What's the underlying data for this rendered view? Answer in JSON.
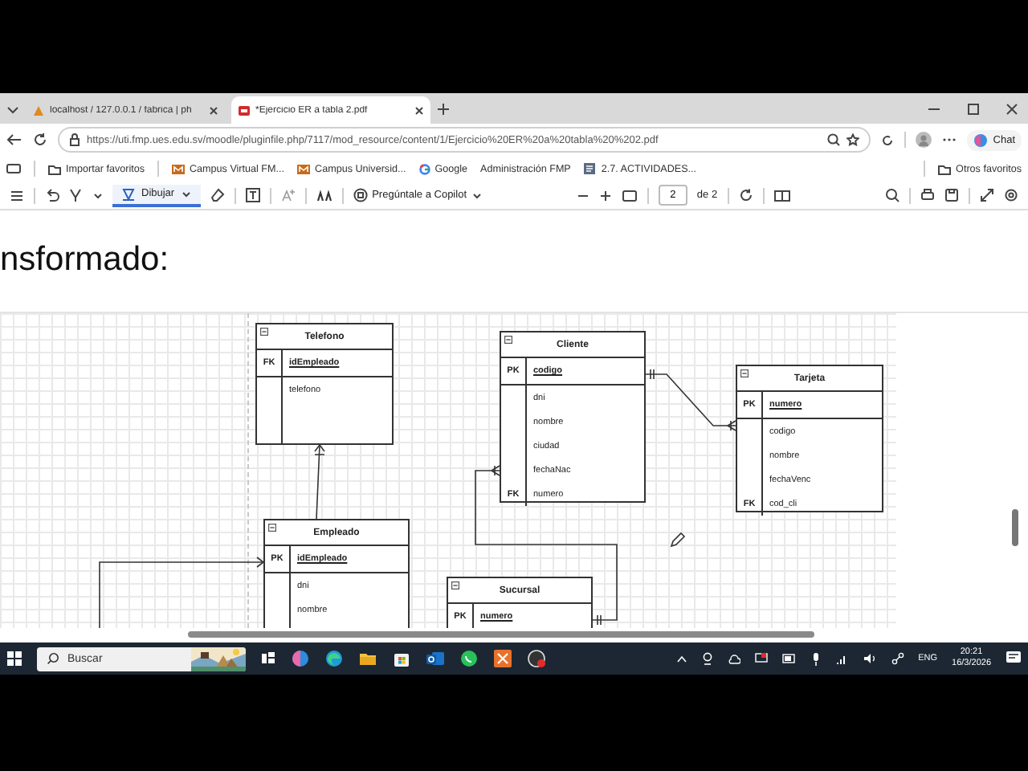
{
  "tabs": [
    {
      "title": "localhost / 127.0.0.1 / fabrica | ph",
      "selected": false
    },
    {
      "title": "*Ejercicio ER a tabla 2.pdf",
      "selected": true
    }
  ],
  "address": {
    "url": "https://uti.fmp.ues.edu.sv/moodle/pluginfile.php/7117/mod_resource/content/1/Ejercicio%20ER%20a%20tabla%20%202.pdf"
  },
  "chat_button": "Chat",
  "bookmarks": [
    {
      "label": "Importar favoritos",
      "kind": "folder"
    },
    {
      "label": "Campus Virtual FM...",
      "kind": "site"
    },
    {
      "label": "Campus Universid...",
      "kind": "site"
    },
    {
      "label": "Google",
      "kind": "google"
    },
    {
      "label": "Administración FMP",
      "kind": "plain"
    },
    {
      "label": "2.7. ACTIVIDADES...",
      "kind": "doc"
    }
  ],
  "other_favorites": "Otros favoritos",
  "pdf_toolbar": {
    "draw_label": "Dibujar",
    "draw_active": true,
    "copilot_label": "Pregúntale a Copilot",
    "page": "2",
    "page_total": "de 2"
  },
  "document": {
    "heading": "nsformado:",
    "entities": [
      {
        "name": "Telefono",
        "rows": [
          {
            "kind": "key",
            "key": "FK",
            "field": "idEmpleado"
          },
          {
            "kind": "attribute",
            "field": "telefono"
          }
        ]
      },
      {
        "name": "Cliente",
        "rows": [
          {
            "kind": "key",
            "key": "PK",
            "field": "codigo"
          },
          {
            "kind": "attribute",
            "field": "dni"
          },
          {
            "kind": "attribute",
            "field": "nombre"
          },
          {
            "kind": "attribute",
            "field": "ciudad"
          },
          {
            "kind": "attribute",
            "field": "fechaNac"
          },
          {
            "kind": "attribute",
            "key": "FK",
            "field": "numero"
          }
        ]
      },
      {
        "name": "Tarjeta",
        "rows": [
          {
            "kind": "key",
            "key": "PK",
            "field": "numero"
          },
          {
            "kind": "attribute",
            "field": "codigo"
          },
          {
            "kind": "attribute",
            "field": "nombre"
          },
          {
            "kind": "attribute",
            "field": "fechaVenc"
          },
          {
            "kind": "attribute",
            "key": "FK",
            "field": "cod_cli"
          }
        ]
      },
      {
        "name": "Empleado",
        "rows": [
          {
            "kind": "key",
            "key": "PK",
            "field": "idEmpleado"
          },
          {
            "kind": "attribute",
            "field": "dni"
          },
          {
            "kind": "attribute",
            "field": "nombre"
          }
        ]
      },
      {
        "name": "Sucursal",
        "rows": [
          {
            "kind": "key",
            "key": "PK",
            "field": "numero"
          }
        ]
      }
    ]
  },
  "taskbar": {
    "search_placeholder": "Buscar",
    "language": "ENG",
    "time": "20:21",
    "date": "16/3/2026"
  }
}
